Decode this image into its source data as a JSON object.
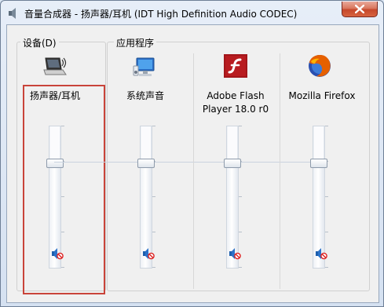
{
  "window": {
    "title": "音量合成器 - 扬声器/耳机 (IDT High Definition Audio CODEC)",
    "icon": "speaker-icon"
  },
  "device_group": {
    "label": "设备(D)",
    "channel": {
      "label": "扬声器/耳机",
      "icon": "laptop-speaker-icon",
      "level": 0.72,
      "muted": true
    }
  },
  "apps_group": {
    "label": "应用程序",
    "channels": [
      {
        "label": "系统声音",
        "icon": "system-sounds-icon",
        "level": 0.72,
        "muted": true
      },
      {
        "label": "Adobe Flash\nPlayer 18.0 r0",
        "icon": "flash-player-icon",
        "level": 0.72,
        "muted": true
      },
      {
        "label": "Mozilla Firefox",
        "icon": "firefox-icon",
        "level": 0.72,
        "muted": true
      }
    ]
  },
  "colors": {
    "selection_border": "#c9443a",
    "close_button": "#c6482b",
    "flash_red": "#a3161a",
    "firefox_orange": "#e66000",
    "mute_blue": "#1d5fae"
  }
}
